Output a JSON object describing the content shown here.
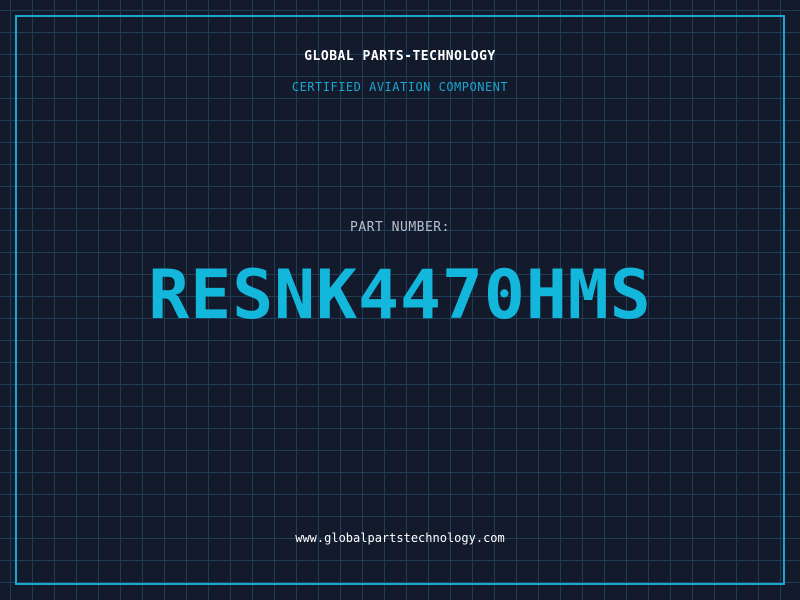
{
  "header": {
    "brand": "GLOBAL PARTS-TECHNOLOGY",
    "tagline": "CERTIFIED AVIATION COMPONENT"
  },
  "part": {
    "label": "PART NUMBER:",
    "number": "RESNK4470HMS"
  },
  "footer": {
    "website": "www.globalpartstechnology.com"
  },
  "colors": {
    "background": "#121a2c",
    "grid": "#1d3e55",
    "accent": "#1aa6cf",
    "part_number": "#14b7dc",
    "text_primary": "#ffffff",
    "text_muted": "#b7c0cc"
  }
}
